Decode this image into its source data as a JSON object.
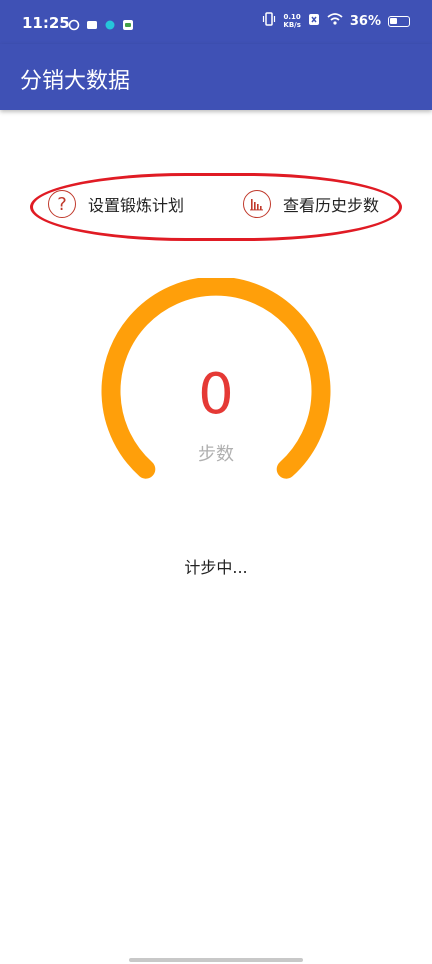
{
  "status_bar": {
    "time": "11:25",
    "net_speed_value": "0.10",
    "net_speed_unit": "KB/s",
    "battery": "36%"
  },
  "app_bar": {
    "title": "分销大数据"
  },
  "actions": {
    "setup_label": "设置锻炼计划",
    "history_label": "查看历史步数"
  },
  "gauge": {
    "value": "0",
    "label": "步数",
    "progress": 0,
    "track_color": "#ff9f0a"
  },
  "status": {
    "text": "计步中..."
  },
  "colors": {
    "primary": "#3f51b5",
    "accent_red": "#e53935",
    "highlight_border": "#e01b24"
  }
}
